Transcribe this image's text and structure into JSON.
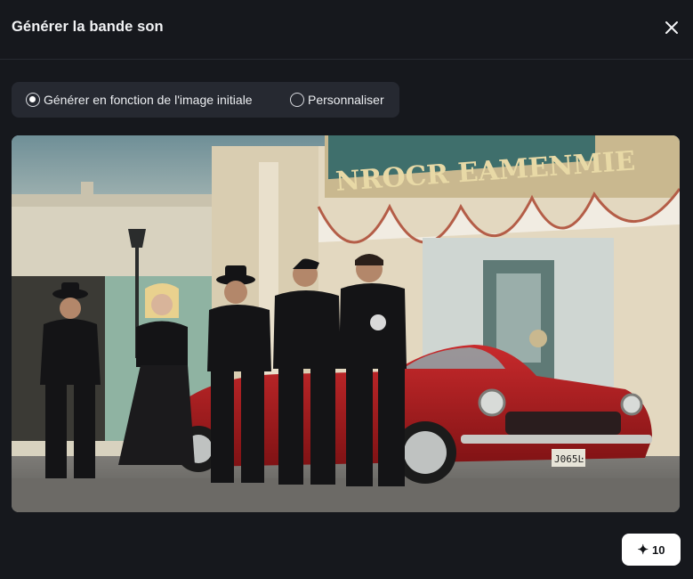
{
  "dialog": {
    "title": "Générer la bande son",
    "close_icon": "close-icon"
  },
  "mode": {
    "options": [
      {
        "label": "Générer en fonction de l'image initiale",
        "checked": true
      },
      {
        "label": "Personnaliser",
        "checked": false
      }
    ]
  },
  "image": {
    "sign_text": "NROCR EAMENMIE",
    "plate_text": "J065Ŀ"
  },
  "generate": {
    "icon": "sparkle-icon",
    "credits": "10"
  }
}
